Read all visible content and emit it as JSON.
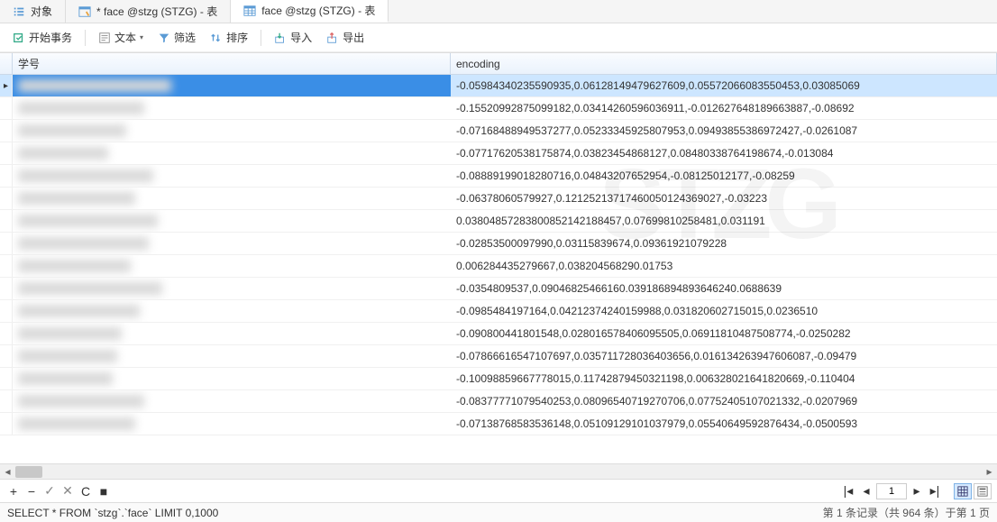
{
  "tabs": [
    {
      "label": "对象",
      "icon": "list"
    },
    {
      "label": "* face @stzg (STZG) - 表",
      "icon": "query"
    },
    {
      "label": "face @stzg (STZG) - 表",
      "icon": "table"
    }
  ],
  "active_tab": 2,
  "toolbar": {
    "begin_transaction": "开始事务",
    "text": "文本",
    "filter": "筛选",
    "sort": "排序",
    "import": "导入",
    "export": "导出"
  },
  "columns": {
    "c1": "学号",
    "c2": "encoding"
  },
  "rows": [
    {
      "selected": true,
      "c1_blur_w": 170,
      "c2": "-0.05984340235590935,0.06128149479627609,0.05572066083550453,0.03085069"
    },
    {
      "c1_blur_w": 140,
      "c2": "-0.15520992875099182,0.03414260596036911,-0.012627648189663887,-0.08692"
    },
    {
      "c1_blur_w": 120,
      "c2": "-0.07168488949537277,0.05233345925807953,0.09493855386972427,-0.0261087"
    },
    {
      "c1_blur_w": 100,
      "c2": "-0.07717620538175874,0.03823454868127,0.08480338764198674,-0.013084"
    },
    {
      "c1_blur_w": 150,
      "c2": "-0.08889199018280716,0.04843207652954,-0.08125012177,-0.08259"
    },
    {
      "c1_blur_w": 130,
      "c2": "-0.06378060579927,0.12125213717460050124369027,-0.03223"
    },
    {
      "c1_blur_w": 155,
      "c2": "0.03804857283800852142188457,0.07699810258481,0.031191"
    },
    {
      "c1_blur_w": 145,
      "c2": "-0.02853500097990,0.03115839674,0.09361921079228"
    },
    {
      "c1_blur_w": 125,
      "c2": "0.006284435279667,0.038204568290.01753"
    },
    {
      "c1_blur_w": 160,
      "c2": "-0.0354809537,0.09046825466160.039186894893646240.0688639"
    },
    {
      "c1_blur_w": 135,
      "c2": "-0.0985484197164,0.04212374240159988,0.031820602715015,0.0236510"
    },
    {
      "c1_blur_w": 115,
      "c2": "-0.090800441801548,0.028016578406095505,0.06911810487508774,-0.0250282"
    },
    {
      "c1_blur_w": 110,
      "c2": "-0.07866616547107697,0.035711728036403656,0.016134263947606087,-0.09479"
    },
    {
      "c1_blur_w": 105,
      "c2": "-0.10098859667778015,0.11742879450321198,0.006328021641820669,-0.110404"
    },
    {
      "c1_blur_w": 140,
      "c2": "-0.08377771079540253,0.08096540719270706,0.07752405107021332,-0.0207969"
    },
    {
      "c1_blur_w": 130,
      "c2": "-0.07138768583536148,0.05109129101037979,0.05540649592876434,-0.0500593"
    }
  ],
  "pager": {
    "current": "1"
  },
  "status": {
    "sql": "SELECT * FROM `stzg`.`face` LIMIT 0,1000",
    "info": "第 1 条记录（共 964 条）于第 1 页"
  },
  "watermark": "STZG"
}
